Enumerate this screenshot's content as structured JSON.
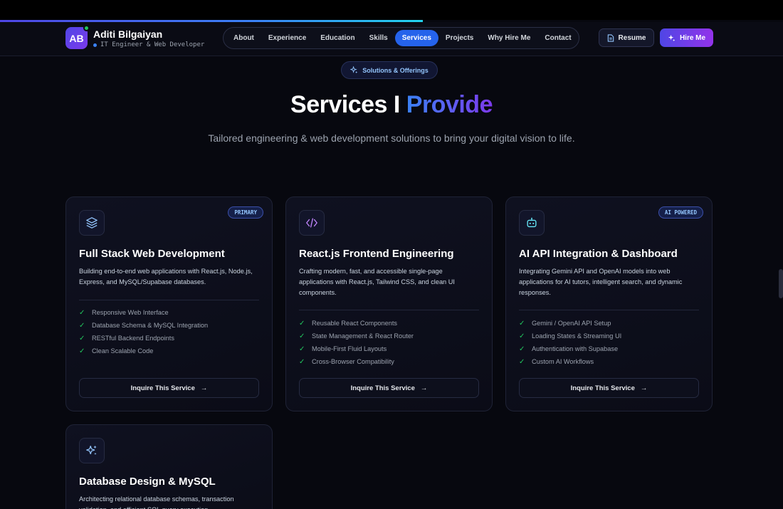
{
  "header": {
    "logo_initials": "AB",
    "brand_name": "Aditi Bilgaiyan",
    "brand_subtitle": "IT Engineer & Web Developer",
    "nav": [
      {
        "label": "About",
        "active": false
      },
      {
        "label": "Experience",
        "active": false
      },
      {
        "label": "Education",
        "active": false
      },
      {
        "label": "Skills",
        "active": false
      },
      {
        "label": "Services",
        "active": true
      },
      {
        "label": "Projects",
        "active": false
      },
      {
        "label": "Why Hire Me",
        "active": false
      },
      {
        "label": "Contact",
        "active": false
      }
    ],
    "resume_label": "Resume",
    "hire_label": "Hire Me"
  },
  "scroll_progress": 0.54,
  "section": {
    "pill_label": "Solutions & Offerings",
    "title_main": "Services I",
    "title_accent": "Provide",
    "subtitle": "Tailored engineering & web development solutions to bring your digital vision to life."
  },
  "cards": [
    {
      "icon": "layers-icon",
      "badge": "PRIMARY",
      "title": "Full Stack Web Development",
      "description": "Building end-to-end web applications with React.js, Node.js, Express, and MySQL/Supabase databases.",
      "features": [
        "Responsive Web Interface",
        "Database Schema & MySQL Integration",
        "RESTful Backend Endpoints",
        "Clean Scalable Code"
      ],
      "cta": "Inquire This Service"
    },
    {
      "icon": "code-icon",
      "badge": "",
      "title": "React.js Frontend Engineering",
      "description": "Crafting modern, fast, and accessible single-page applications with React.js, Tailwind CSS, and clean UI components.",
      "features": [
        "Reusable React Components",
        "State Management & React Router",
        "Mobile-First Fluid Layouts",
        "Cross-Browser Compatibility"
      ],
      "cta": "Inquire This Service"
    },
    {
      "icon": "bot-icon",
      "badge": "AI POWERED",
      "title": "AI API Integration & Dashboard",
      "description": "Integrating Gemini API and OpenAI models into web applications for AI tutors, intelligent search, and dynamic responses.",
      "features": [
        "Gemini / OpenAI API Setup",
        "Loading States & Streaming UI",
        "Authentication with Supabase",
        "Custom AI Workflows"
      ],
      "cta": "Inquire This Service"
    },
    {
      "icon": "sparkles-icon",
      "badge": "",
      "title": "Database Design & MySQL",
      "description": "Architecting relational database schemas, transaction validation, and efficient SQL query execution.",
      "features": [],
      "cta": ""
    }
  ],
  "colors": {
    "background": "#07080f",
    "accent_blue": "#2563eb",
    "accent_purple": "#9333ea",
    "check_green": "#22c55e"
  }
}
